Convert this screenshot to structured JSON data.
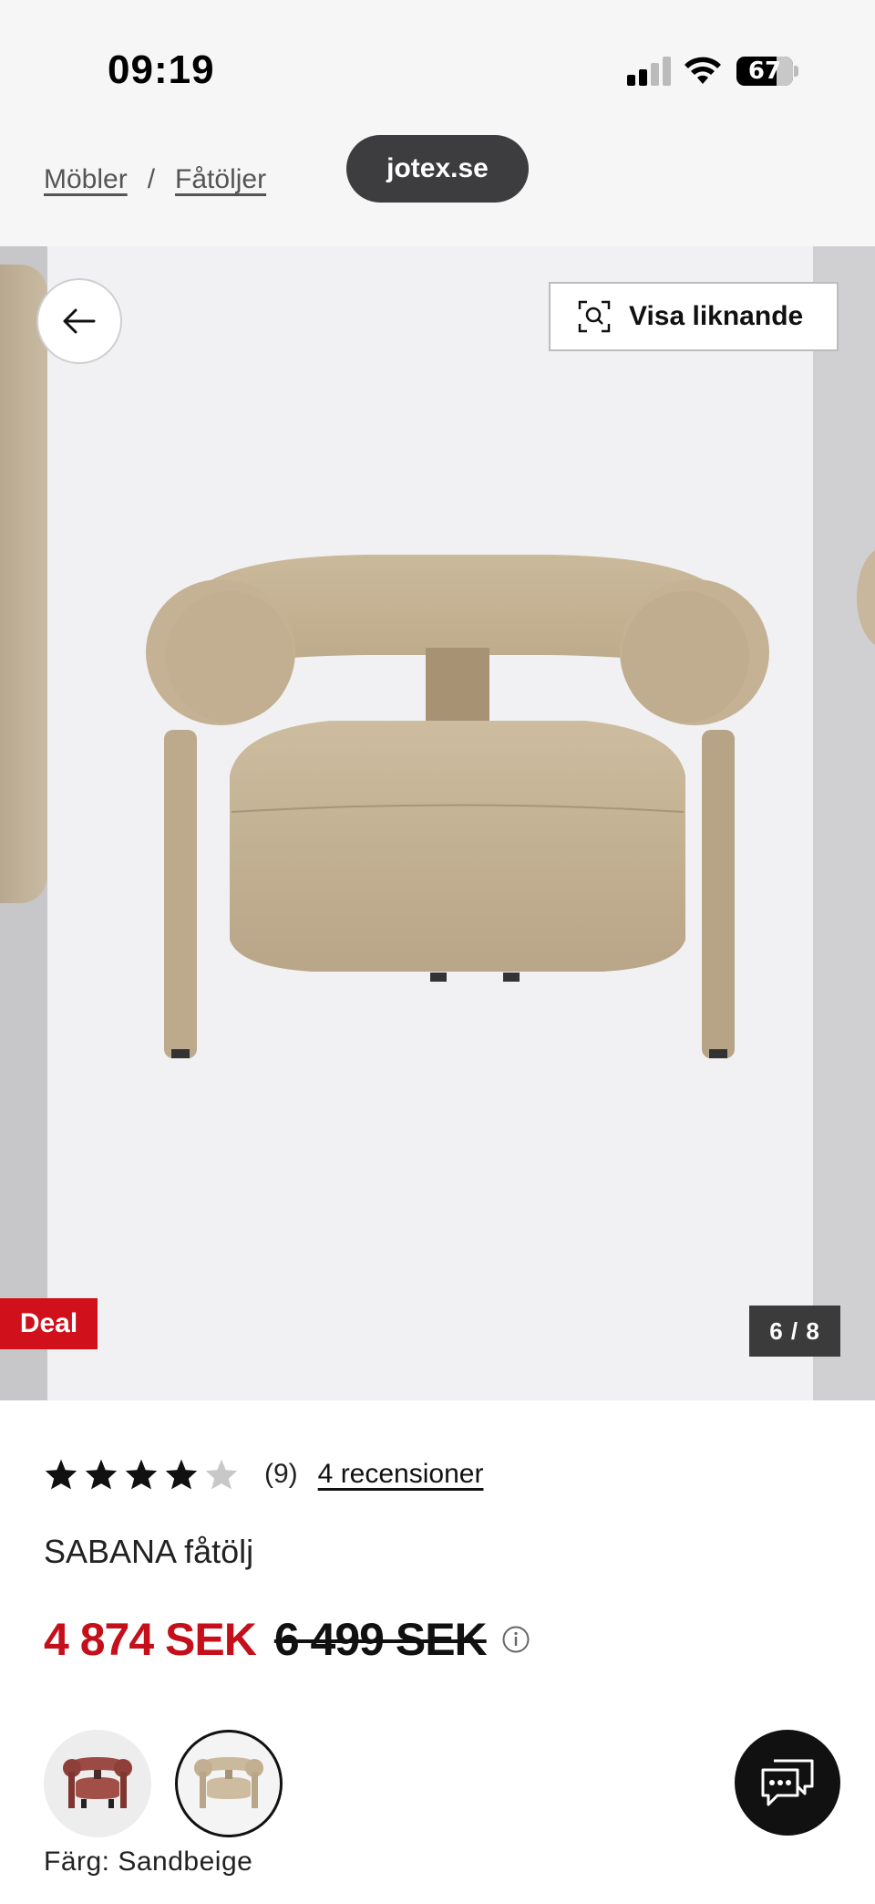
{
  "status_bar": {
    "time": "09:19",
    "battery": "67"
  },
  "breadcrumb": {
    "items": [
      "Möbler",
      "Fåtöljer"
    ],
    "separator": "/"
  },
  "browser": {
    "domain": "jotex.se"
  },
  "gallery": {
    "similar_button": "Visa liknande",
    "badge": "Deal",
    "counter": "6 / 8"
  },
  "product": {
    "rating_value": 4,
    "rating_max": 5,
    "rating_count": "(9)",
    "reviews_link": "4 recensioner",
    "name": "SABANA fåtölj",
    "price_now": "4 874 SEK",
    "price_old": "6 499 SEK",
    "color_label": "Färg: Sandbeige",
    "swatches": [
      {
        "color": "#9b4a44",
        "selected": false
      },
      {
        "color": "#c9b394",
        "selected": true
      }
    ]
  },
  "colors": {
    "accent_red": "#d0111b",
    "price_red": "#c50f1b",
    "chair_fabric": "#c7b597"
  }
}
